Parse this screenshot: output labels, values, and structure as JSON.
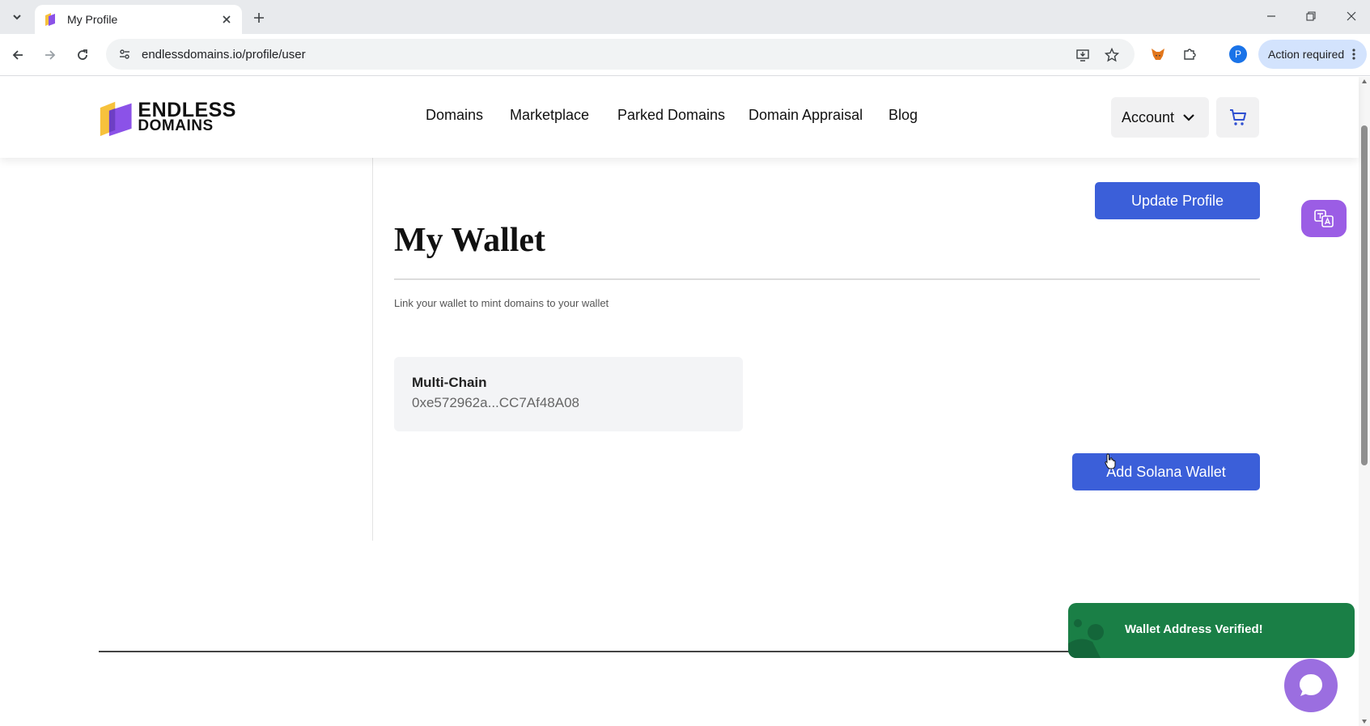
{
  "browser": {
    "tab_title": "My Profile",
    "url": "endlessdomains.io/profile/user",
    "profile_initial": "P",
    "action_required_label": "Action required"
  },
  "site": {
    "logo_line1": "ENDLESS",
    "logo_line2": "DOMAINS",
    "nav": {
      "domains": "Domains",
      "marketplace": "Marketplace",
      "parked": "Parked Domains",
      "appraisal": "Domain Appraisal",
      "blog": "Blog"
    },
    "account_label": "Account"
  },
  "main": {
    "update_profile_label": "Update Profile",
    "title": "My Wallet",
    "subtitle": "Link your wallet to mint domains to your wallet",
    "wallet": {
      "chain": "Multi-Chain",
      "address": "0xe572962a...CC7Af48A08"
    },
    "add_solana_label": "Add Solana Wallet"
  },
  "toast": {
    "message": "Wallet Address Verified!"
  },
  "colors": {
    "primary_button": "#3b5fd9",
    "toast_bg": "#1a7f46",
    "fab_purple": "#9b5de5"
  },
  "icons": {
    "tab_list": "chevron-down-icon",
    "close": "close-icon",
    "new_tab": "plus-icon",
    "back": "arrow-left-icon",
    "forward": "arrow-right-icon",
    "reload": "reload-icon",
    "install": "install-icon",
    "bookmark": "star-icon",
    "extensions": "puzzle-icon",
    "cart": "cart-icon",
    "translate": "translate-icon",
    "chat": "chat-icon"
  }
}
